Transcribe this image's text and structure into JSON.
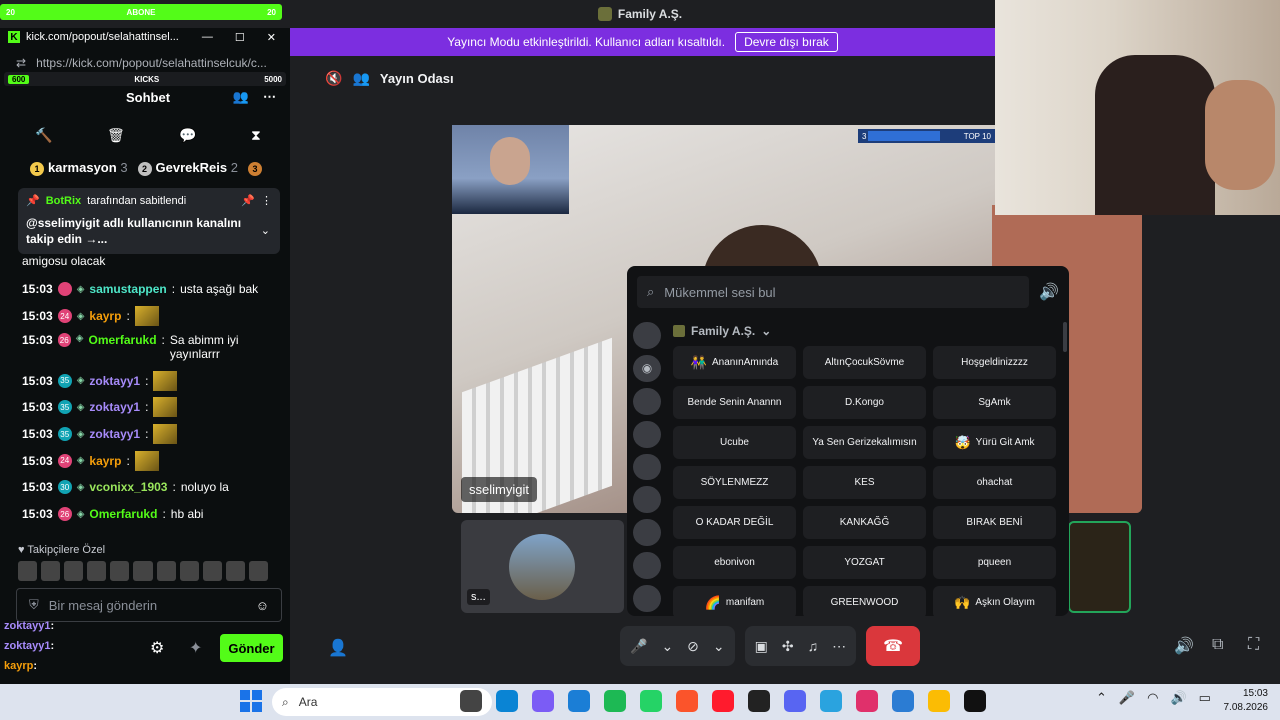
{
  "discord": {
    "server_title": "Family A.Ş.",
    "streamer_banner": "Yayıncı Modu etkinleştirildi. Kullanıcı adları kısaltıldı.",
    "streamer_disable": "Devre dışı bırak",
    "room_name": "Yayın Odası",
    "main_stream_user": "sselimyigit",
    "thumb_label": "s...",
    "top10_left": "3",
    "top10_right": "TOP 10"
  },
  "soundboard": {
    "search_placeholder": "Mükemmel sesi bul",
    "category": "Family A.Ş.",
    "sounds": [
      {
        "label": "AnanınAmında",
        "emoji": "👫"
      },
      {
        "label": "AltınÇocukSövme",
        "emoji": ""
      },
      {
        "label": "Hoşgeldinizzzz",
        "emoji": ""
      },
      {
        "label": "Bende Senin Anannn",
        "emoji": ""
      },
      {
        "label": "D.Kongo",
        "emoji": ""
      },
      {
        "label": "SgAmk",
        "emoji": ""
      },
      {
        "label": "Ucube",
        "emoji": ""
      },
      {
        "label": "Ya Sen Gerizekalımısın",
        "emoji": ""
      },
      {
        "label": "Yürü Git Amk",
        "emoji": "🤯"
      },
      {
        "label": "SÖYLENMEZZ",
        "emoji": ""
      },
      {
        "label": "KES",
        "emoji": ""
      },
      {
        "label": "ohachat",
        "emoji": ""
      },
      {
        "label": "O KADAR DEĞİL",
        "emoji": ""
      },
      {
        "label": "KANKAĞĞ",
        "emoji": ""
      },
      {
        "label": "BIRAK BENİ",
        "emoji": ""
      },
      {
        "label": "ebonivon",
        "emoji": ""
      },
      {
        "label": "YOZGAT",
        "emoji": ""
      },
      {
        "label": "pqueen",
        "emoji": ""
      },
      {
        "label": "manifam",
        "emoji": "🌈"
      },
      {
        "label": "GREENWOOD",
        "emoji": ""
      },
      {
        "label": "Aşkın Olayım",
        "emoji": "🙌"
      }
    ]
  },
  "overlay": {
    "abone_left": "20",
    "abone_label": "ABONE",
    "abone_right": "20",
    "kicks_left": "600",
    "kicks_label": "KICKS",
    "kicks_right": "5000",
    "chat": [
      {
        "user": "zoktayy1",
        "text": ":"
      },
      {
        "user": "zoktayy1",
        "text": ":"
      },
      {
        "user": "kayrp",
        "text": ":"
      },
      {
        "user": "vconixx_1903",
        "text": ": noluyo la"
      },
      {
        "user": "Omerfarukd",
        "text": ": hb abi"
      }
    ]
  },
  "kick": {
    "window_title": "kick.com/popout/selahattinsel...",
    "url": "https://kick.com/popout/selahattinselcuk/c...",
    "chat_title": "Sohbet",
    "leaders": [
      {
        "rank": "1",
        "name": "karmasyon",
        "count": "3"
      },
      {
        "rank": "2",
        "name": "GevrekReis",
        "count": "2"
      },
      {
        "rank": "3",
        "name": "",
        "count": ""
      }
    ],
    "pinned_by": "BotRix",
    "pinned_suffix": "tarafından sabitlendi",
    "pinned_message": "@sselimyigit adlı kullanıcının kanalını takip edin →...",
    "prev_message": "amigosu olacak",
    "messages": [
      {
        "time": "15:03",
        "badge": "",
        "user": "samustappen",
        "text": "usta aşağı bak",
        "color": "cyan"
      },
      {
        "time": "15:03",
        "badge": "24",
        "user": "kayrp",
        "text": "",
        "color": "orange",
        "emote": true
      },
      {
        "time": "15:03",
        "badge": "26",
        "user": "Omerfarukd",
        "text": "Sa abimm iyi yayınlarrr",
        "color": "green"
      },
      {
        "time": "15:03",
        "badge": "35",
        "user": "zoktayy1",
        "text": "",
        "color": "purple",
        "emote": true
      },
      {
        "time": "15:03",
        "badge": "35",
        "user": "zoktayy1",
        "text": "",
        "color": "purple",
        "emote": true
      },
      {
        "time": "15:03",
        "badge": "35",
        "user": "zoktayy1",
        "text": "",
        "color": "purple",
        "emote": true
      },
      {
        "time": "15:03",
        "badge": "24",
        "user": "kayrp",
        "text": "",
        "color": "orange",
        "emote": true
      },
      {
        "time": "15:03",
        "badge": "30",
        "user": "vconixx_1903",
        "text": "noluyo la",
        "color": "lime"
      },
      {
        "time": "15:03",
        "badge": "26",
        "user": "Omerfarukd",
        "text": "hb abi",
        "color": "green"
      }
    ],
    "followers_label": "Takipçilere Özel",
    "input_placeholder": "Bir mesaj gönderin",
    "send_label": "Gönder"
  },
  "taskbar": {
    "search_placeholder": "Ara",
    "time": "15:03",
    "date": "7.08.2026"
  }
}
